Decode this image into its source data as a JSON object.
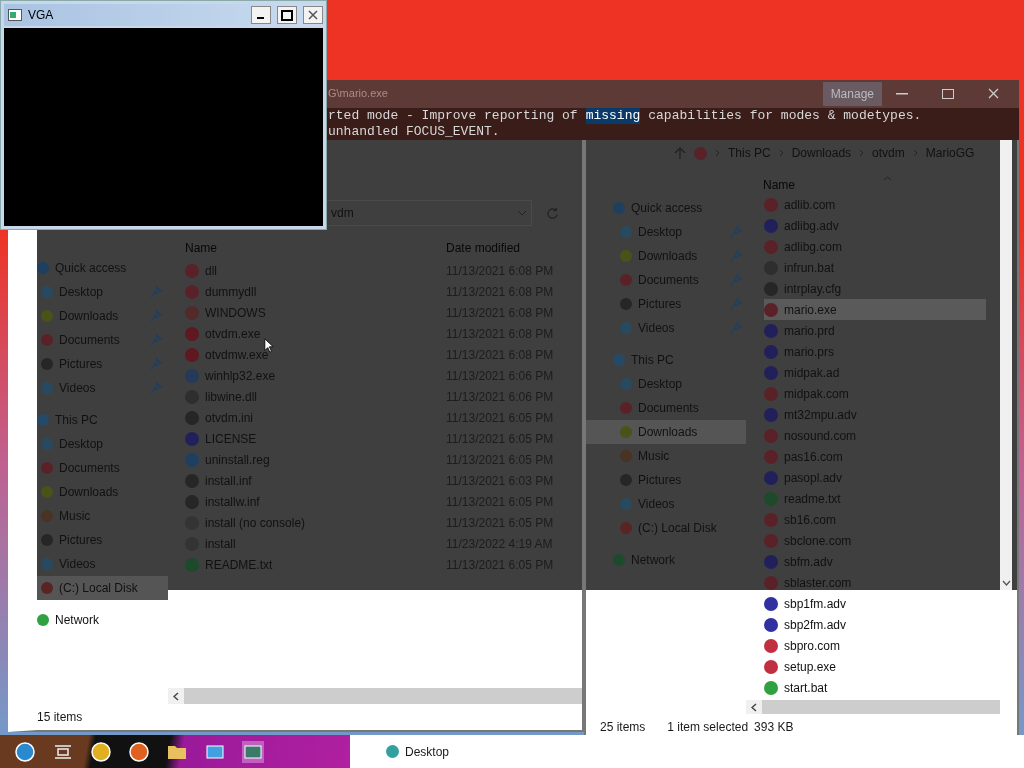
{
  "vga_window": {
    "title": "VGA"
  },
  "console": {
    "title": "G\\mario.exe",
    "ribbon_tab": "Manage",
    "lines": [
      [
        {
          "text": "rted mode - Improve reporting of",
          "selected": false
        },
        {
          "text": "missing",
          "selected": true
        },
        {
          "text": "capabilities for modes & modetypes.",
          "selected": false
        }
      ],
      [
        {
          "text": "unhandled FOCUS_EVENT.",
          "selected": false
        }
      ]
    ]
  },
  "left_explorer": {
    "address": "vdm",
    "columns": [
      "Name",
      "Date modified"
    ],
    "sidebar": [
      {
        "label": "Quick access",
        "color": "#1f3f60",
        "selected": false,
        "children": [
          {
            "label": "Desktop",
            "color": "#284a60",
            "selected": false,
            "pinned": true
          },
          {
            "label": "Downloads",
            "color": "#4a5218",
            "selected": false,
            "pinned": true
          },
          {
            "label": "Documents",
            "color": "#5a2228",
            "selected": false,
            "pinned": true
          },
          {
            "label": "Pictures",
            "color": "#262626",
            "selected": false,
            "pinned": true
          },
          {
            "label": "Videos",
            "color": "#284a60",
            "selected": false,
            "pinned": true
          }
        ]
      },
      {
        "label": "This PC",
        "color": "#244a68",
        "selected": false,
        "children": [
          {
            "label": "Desktop",
            "color": "#284a60",
            "selected": false,
            "pinned": false
          },
          {
            "label": "Documents",
            "color": "#5a2228",
            "selected": false,
            "pinned": false
          },
          {
            "label": "Downloads",
            "color": "#4a5218",
            "selected": false,
            "pinned": false
          },
          {
            "label": "Music",
            "color": "#4a3224",
            "selected": false,
            "pinned": false
          },
          {
            "label": "Pictures",
            "color": "#262626",
            "selected": false,
            "pinned": false
          },
          {
            "label": "Videos",
            "color": "#284a60",
            "selected": false,
            "pinned": false
          },
          {
            "label": "(C:) Local Disk",
            "color": "#5a2424",
            "selected": true,
            "pinned": false
          }
        ]
      },
      {
        "label": "Network",
        "color": "#30a040",
        "selected": false
      }
    ],
    "files": [
      {
        "name": "dll",
        "date": "11/13/2021 6:08 PM",
        "color": "#5a2228",
        "selected": false
      },
      {
        "name": "dummydll",
        "date": "11/13/2021 6:08 PM",
        "color": "#5a2228",
        "selected": false
      },
      {
        "name": "WINDOWS",
        "date": "11/13/2021 6:08 PM",
        "color": "#522a2a",
        "selected": false
      },
      {
        "name": "otvdm.exe",
        "date": "11/13/2021 6:08 PM",
        "color": "#601820",
        "selected": false
      },
      {
        "name": "otvdmw.exe",
        "date": "11/13/2021 6:08 PM",
        "color": "#601820",
        "selected": false
      },
      {
        "name": "winhlp32.exe",
        "date": "11/13/2021 6:06 PM",
        "color": "#243a58",
        "selected": false
      },
      {
        "name": "libwine.dll",
        "date": "11/13/2021 6:06 PM",
        "color": "#2e2e2e",
        "selected": false
      },
      {
        "name": "otvdm.ini",
        "date": "11/13/2021 6:05 PM",
        "color": "#262626",
        "selected": false
      },
      {
        "name": "LICENSE",
        "date": "11/13/2021 6:05 PM",
        "color": "#22205a",
        "selected": false
      },
      {
        "name": "uninstall.reg",
        "date": "11/13/2021 6:05 PM",
        "color": "#1f3f60",
        "selected": false
      },
      {
        "name": "install.inf",
        "date": "11/13/2021 6:03 PM",
        "color": "#262626",
        "selected": false
      },
      {
        "name": "installw.inf",
        "date": "11/13/2021 6:05 PM",
        "color": "#262626",
        "selected": false
      },
      {
        "name": "install (no console)",
        "date": "11/13/2021 6:05 PM",
        "color": "#343434",
        "selected": false
      },
      {
        "name": "install",
        "date": "11/23/2022 4:19 AM",
        "color": "#343434",
        "selected": false
      },
      {
        "name": "README.txt",
        "date": "11/13/2021 6:05 PM",
        "color": "#1c4a2a",
        "selected": false
      }
    ],
    "status": "15 items"
  },
  "right_explorer": {
    "breadcrumb": [
      "This PC",
      "Downloads",
      "otvdm",
      "MarioGG"
    ],
    "columns": [
      "Name"
    ],
    "sidebar": [
      {
        "label": "Quick access",
        "color": "#1f3f60",
        "selected": false,
        "children": [
          {
            "label": "Desktop",
            "color": "#284a60",
            "selected": false,
            "pinned": true
          },
          {
            "label": "Downloads",
            "color": "#4a5218",
            "selected": false,
            "pinned": true
          },
          {
            "label": "Documents",
            "color": "#5a2228",
            "selected": false,
            "pinned": true
          },
          {
            "label": "Pictures",
            "color": "#262626",
            "selected": false,
            "pinned": true
          },
          {
            "label": "Videos",
            "color": "#284a60",
            "selected": false,
            "pinned": true
          }
        ]
      },
      {
        "label": "This PC",
        "color": "#244a68",
        "selected": false,
        "children": [
          {
            "label": "Desktop",
            "color": "#284a60",
            "selected": false,
            "pinned": false
          },
          {
            "label": "Documents",
            "color": "#5a2228",
            "selected": false,
            "pinned": false
          },
          {
            "label": "Downloads",
            "color": "#4a5218",
            "selected": true,
            "pinned": false
          },
          {
            "label": "Music",
            "color": "#4a3224",
            "selected": false,
            "pinned": false
          },
          {
            "label": "Pictures",
            "color": "#262626",
            "selected": false,
            "pinned": false
          },
          {
            "label": "Videos",
            "color": "#284a60",
            "selected": false,
            "pinned": false
          },
          {
            "label": "(C:) Local Disk",
            "color": "#5a2424",
            "selected": false,
            "pinned": false
          }
        ]
      },
      {
        "label": "Network",
        "color": "#1c4a2a",
        "selected": false
      }
    ],
    "files": [
      {
        "name": "adlib.com",
        "color": "#5a2228",
        "selected": false
      },
      {
        "name": "adlibg.adv",
        "color": "#22205a",
        "selected": false
      },
      {
        "name": "adlibg.com",
        "color": "#5a2228",
        "selected": false
      },
      {
        "name": "infrun.bat",
        "color": "#2e2e2e",
        "selected": false
      },
      {
        "name": "intrplay.cfg",
        "color": "#262626",
        "selected": false
      },
      {
        "name": "mario.exe",
        "color": "#5a2228",
        "selected": true
      },
      {
        "name": "mario.prd",
        "color": "#22205a",
        "selected": false
      },
      {
        "name": "mario.prs",
        "color": "#22205a",
        "selected": false
      },
      {
        "name": "midpak.ad",
        "color": "#22205a",
        "selected": false
      },
      {
        "name": "midpak.com",
        "color": "#5a2228",
        "selected": false
      },
      {
        "name": "mt32mpu.adv",
        "color": "#22205a",
        "selected": false
      },
      {
        "name": "nosound.com",
        "color": "#5a2228",
        "selected": false
      },
      {
        "name": "pas16.com",
        "color": "#5a2228",
        "selected": false
      },
      {
        "name": "pasopl.adv",
        "color": "#22205a",
        "selected": false
      },
      {
        "name": "readme.txt",
        "color": "#1c4a2a",
        "selected": false
      },
      {
        "name": "sb16.com",
        "color": "#5a2228",
        "selected": false
      },
      {
        "name": "sbclone.com",
        "color": "#5a2228",
        "selected": false
      },
      {
        "name": "sbfm.adv",
        "color": "#22205a",
        "selected": false
      },
      {
        "name": "sblaster.com",
        "color": "#5a2228",
        "selected": false
      },
      {
        "name": "sbp1fm.adv",
        "color": "#3030a0",
        "selected": false
      },
      {
        "name": "sbp2fm.adv",
        "color": "#3030a0",
        "selected": false
      },
      {
        "name": "sbpro.com",
        "color": "#c03040",
        "selected": false
      },
      {
        "name": "setup.exe",
        "color": "#c03040",
        "selected": false
      },
      {
        "name": "start.bat",
        "color": "#30a040",
        "selected": false
      }
    ],
    "status": [
      "25 items",
      "1 item selected",
      "393 KB"
    ]
  },
  "back_window": {
    "sidebar_item": {
      "label": "Desktop",
      "color": "#30a0a0"
    }
  }
}
